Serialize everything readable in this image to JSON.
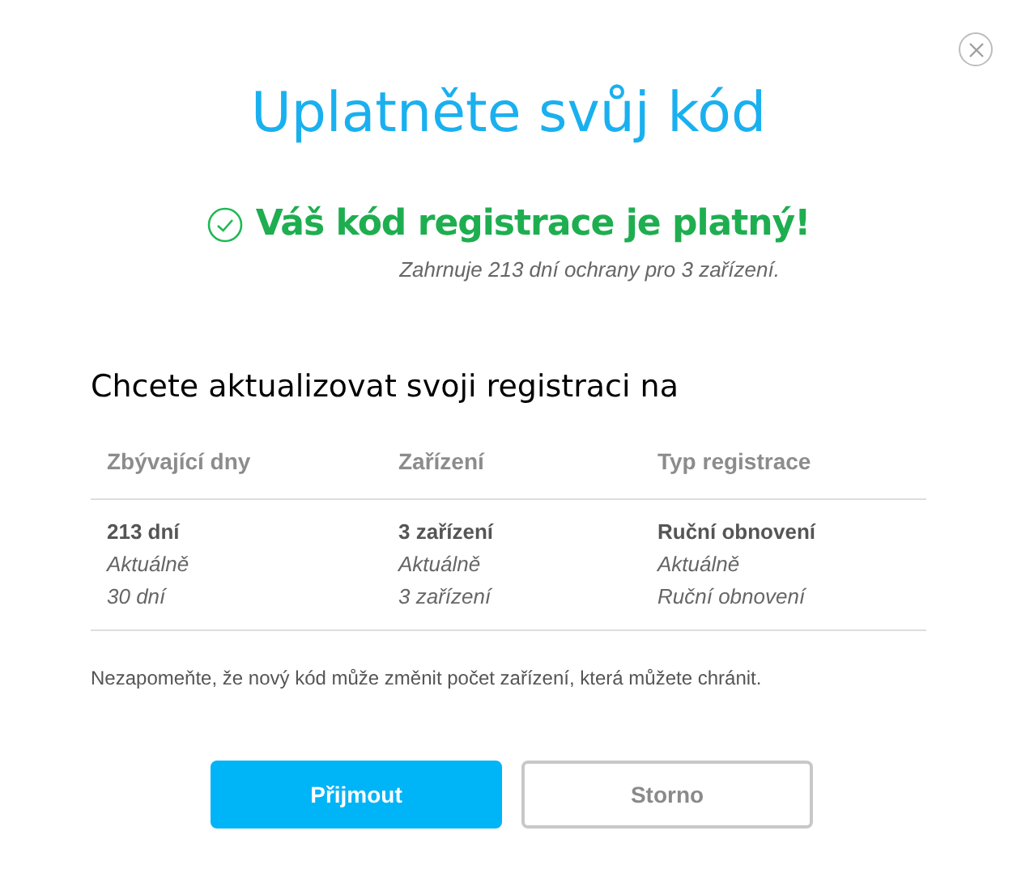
{
  "title": "Uplatněte svůj kód",
  "status": {
    "message": "Váš kód registrace je platný!",
    "detail": "Zahrnuje 213 dní ochrany pro 3 zařízení."
  },
  "section_heading": "Chcete aktualizovat svoji registraci na",
  "table": {
    "columns": [
      "Zbývající dny",
      "Zařízení",
      "Typ registrace"
    ],
    "cells": [
      {
        "new": "213 dní",
        "current_label": "Aktuálně",
        "current": "30 dní"
      },
      {
        "new": "3 zařízení",
        "current_label": "Aktuálně",
        "current": "3 zařízení"
      },
      {
        "new": "Ruční obnovení",
        "current_label": "Aktuálně",
        "current": "Ruční obnovení"
      }
    ]
  },
  "note": "Nezapomeňte, že nový kód může změnit počet zařízení, která můžete chránit.",
  "buttons": [
    {
      "label": "Přijmout",
      "kind": "primary"
    },
    {
      "label": "Storno",
      "kind": "secondary"
    }
  ]
}
